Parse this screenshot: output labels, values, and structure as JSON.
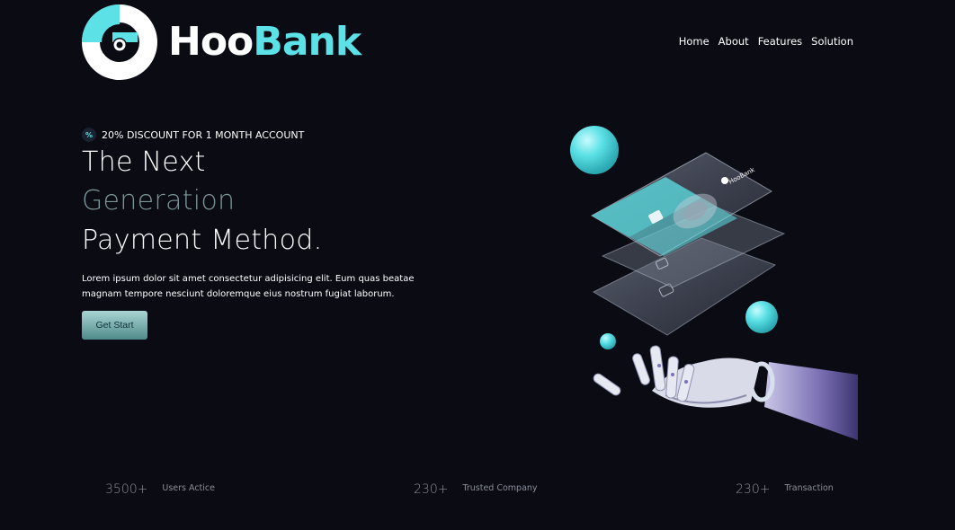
{
  "brand": {
    "name_part1": "Hoo",
    "name_part2": "Bank",
    "accent_color": "#5ce1e6",
    "background_color": "#0a0b13"
  },
  "nav": {
    "items": [
      "Home",
      "About",
      "Features",
      "Solution"
    ]
  },
  "hero": {
    "badge_icon": "percent-icon",
    "badge_text": "20% DISCOUNT FOR 1 MONTH ACCOUNT",
    "headline_line1": "The Next",
    "headline_line2": "Generation",
    "headline_line3": "Payment Method.",
    "description": "Lorem ipsum dolor sit amet consectetur adipisicing elit. Eum quas beatae magnam tempore nesciunt doloremque eius nostrum fugiat laborum.",
    "cta_label": "Get Start"
  },
  "illustration": {
    "card_brand": "HooBank"
  },
  "stats": [
    {
      "value": "3500+",
      "label": "Users Actice"
    },
    {
      "value": "230+",
      "label": "Trusted Company"
    },
    {
      "value": "230+",
      "label": "Transaction"
    }
  ]
}
